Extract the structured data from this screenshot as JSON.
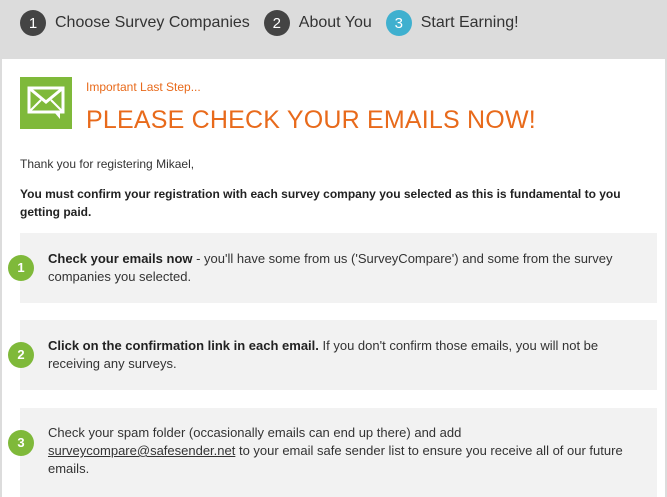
{
  "steps": [
    {
      "num": "1",
      "label": "Choose Survey Companies"
    },
    {
      "num": "2",
      "label": "About You"
    },
    {
      "num": "3",
      "label": "Start Earning!"
    }
  ],
  "header": {
    "icon": "envelope-icon",
    "kicker": "Important Last Step...",
    "headline": "PLEASE CHECK YOUR EMAILS NOW!"
  },
  "thanks": "Thank you for registering Mikael,",
  "must": "You must confirm your registration with each survey company you selected as this is fundamental to you getting paid.",
  "cards": [
    {
      "num": "1",
      "bold": "Check your emails now",
      "text": " - you'll have some from us ('SurveyCompare') and some from the survey companies you selected."
    },
    {
      "num": "2",
      "bold": "Click on the confirmation link in each email.",
      "text": " If you don't confirm those emails, you will not be receiving any surveys."
    },
    {
      "num": "3",
      "text_before": "Check your spam folder (occasionally emails can end up there) and add ",
      "link": "surveycompare@safesender.net",
      "text_after": " to your email safe sender list to ensure you receive all of our future emails."
    }
  ],
  "colors": {
    "accent_orange": "#e86a1b",
    "green": "#7fb93a",
    "active_step": "#3fb0cf",
    "step_dark": "#444444"
  }
}
